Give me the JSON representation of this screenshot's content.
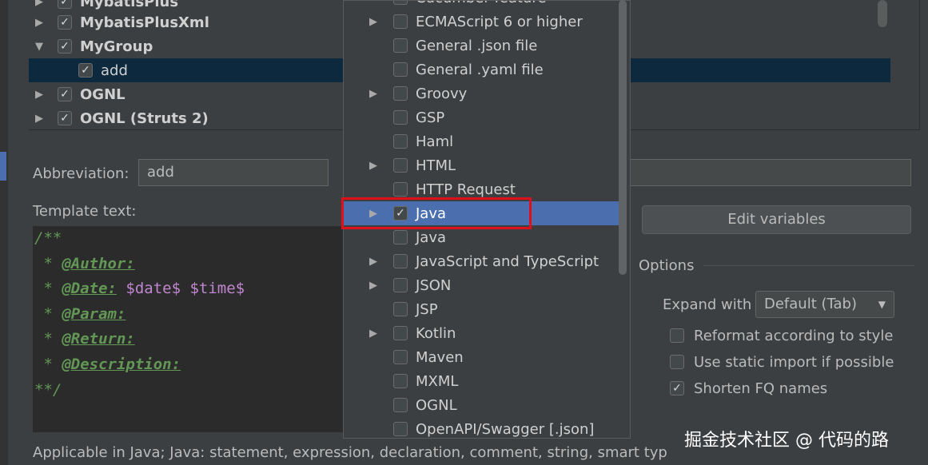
{
  "tree": {
    "rows": [
      {
        "label": "MybatisPlus",
        "arrow": "▶",
        "checked": true,
        "bold": true,
        "selected": false
      },
      {
        "label": "MybatisPlusXml",
        "arrow": "▶",
        "checked": true,
        "bold": true,
        "selected": false
      },
      {
        "label": "MyGroup",
        "arrow": "▼",
        "checked": true,
        "bold": true,
        "selected": false
      },
      {
        "label": "add",
        "arrow": "",
        "checked": true,
        "bold": false,
        "selected": true
      },
      {
        "label": "OGNL",
        "arrow": "▶",
        "checked": true,
        "bold": true,
        "selected": false
      },
      {
        "label": "OGNL (Struts 2)",
        "arrow": "▶",
        "checked": true,
        "bold": true,
        "selected": false
      }
    ]
  },
  "abbreviation": {
    "label": "Abbreviation:",
    "value": "add"
  },
  "template_text": {
    "label": "Template text:"
  },
  "code": {
    "l1": "/**",
    "star": " * ",
    "author": "@Author:",
    "date": "@Date:",
    "date_vars": " $date$ $time$",
    "param": "@Param:",
    "ret": "@Return:",
    "desc": "@Description:",
    "end": "**/"
  },
  "applicable": "Applicable in Java; Java: statement, expression, declaration, comment, string, smart typ",
  "edit_variables_label": "Edit variables",
  "options": {
    "header": "Options",
    "expand_label": "Expand with",
    "expand_value": "Default (Tab)",
    "reformat": "Reformat according to style",
    "static_import": "Use static import if possible",
    "shorten_fq": "Shorten FQ names",
    "reformat_checked": false,
    "static_import_checked": false,
    "shorten_fq_checked": true
  },
  "context_menu": {
    "items": [
      {
        "label": "Cucumber feature",
        "arrow": "",
        "checked": false,
        "selected": false
      },
      {
        "label": "ECMAScript 6 or higher",
        "arrow": "▶",
        "checked": false,
        "selected": false
      },
      {
        "label": "General .json file",
        "arrow": "",
        "checked": false,
        "selected": false
      },
      {
        "label": "General .yaml file",
        "arrow": "",
        "checked": false,
        "selected": false
      },
      {
        "label": "Groovy",
        "arrow": "▶",
        "checked": false,
        "selected": false
      },
      {
        "label": "GSP",
        "arrow": "",
        "checked": false,
        "selected": false
      },
      {
        "label": "Haml",
        "arrow": "",
        "checked": false,
        "selected": false
      },
      {
        "label": "HTML",
        "arrow": "▶",
        "checked": false,
        "selected": false
      },
      {
        "label": "HTTP Request",
        "arrow": "",
        "checked": false,
        "selected": false
      },
      {
        "label": "Java",
        "arrow": "▶",
        "checked": true,
        "selected": true
      },
      {
        "label": "Java",
        "arrow": "",
        "checked": false,
        "selected": false
      },
      {
        "label": "JavaScript and TypeScript",
        "arrow": "▶",
        "checked": false,
        "selected": false
      },
      {
        "label": "JSON",
        "arrow": "▶",
        "checked": false,
        "selected": false
      },
      {
        "label": "JSP",
        "arrow": "",
        "checked": false,
        "selected": false
      },
      {
        "label": "Kotlin",
        "arrow": "▶",
        "checked": false,
        "selected": false
      },
      {
        "label": "Maven",
        "arrow": "",
        "checked": false,
        "selected": false
      },
      {
        "label": "MXML",
        "arrow": "",
        "checked": false,
        "selected": false
      },
      {
        "label": "OGNL",
        "arrow": "",
        "checked": false,
        "selected": false
      },
      {
        "label": "OpenAPI/Swagger [.json]",
        "arrow": "",
        "checked": false,
        "selected": false
      }
    ]
  },
  "watermark": "掘金技术社区 @ 代码的路",
  "colors": {
    "selection": "#4b6eaf",
    "tree_selection": "#0d293e",
    "highlight": "#e0101a",
    "comment": "#629755",
    "variable": "#c086d0"
  }
}
